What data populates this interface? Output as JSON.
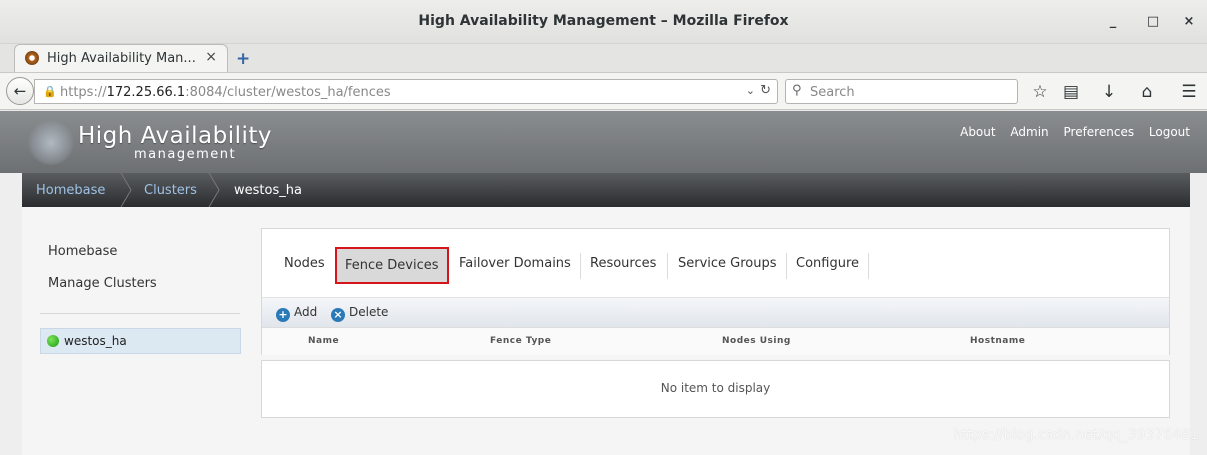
{
  "window": {
    "title": "High Availability Management – Mozilla Firefox",
    "minimize": "_",
    "maximize": "□",
    "close": "×"
  },
  "browser": {
    "tab_label": "High Availability Man...",
    "tab_close": "×",
    "new_tab": "+",
    "url_scheme": "https://",
    "url_host": "172.25.66.1",
    "url_rest": ":8084/cluster/westos_ha/fences",
    "search_placeholder": "Search",
    "icons": [
      "back-arrow-icon",
      "lock-icon",
      "reload-icon",
      "search-icon",
      "bookmark-star-icon",
      "reading-list-icon",
      "download-icon",
      "home-icon",
      "menu-icon"
    ]
  },
  "app": {
    "logo_title": "High Availability",
    "logo_subtitle": "management",
    "top_links": [
      "About",
      "Admin",
      "Preferences",
      "Logout"
    ]
  },
  "breadcrumb": [
    "Homebase",
    "Clusters",
    "westos_ha"
  ],
  "sidebar": {
    "links": [
      "Homebase",
      "Manage Clusters"
    ],
    "cluster": {
      "name": "westos_ha",
      "status_color": "#1b9d10"
    }
  },
  "tabs": [
    "Nodes",
    "Fence Devices",
    "Failover Domains",
    "Resources",
    "Service Groups",
    "Configure"
  ],
  "active_tab": "Fence Devices",
  "actions": {
    "add": "Add",
    "delete": "Delete"
  },
  "table": {
    "columns": [
      "Name",
      "Fence Type",
      "Nodes Using",
      "Hostname"
    ],
    "empty_message": "No item to display"
  },
  "watermark": "https://blog.csdn.net/qq_39376481",
  "colors": {
    "accent": "#d7141a",
    "link": "#9ec2e6",
    "action_icon": "#2a7ab8"
  }
}
